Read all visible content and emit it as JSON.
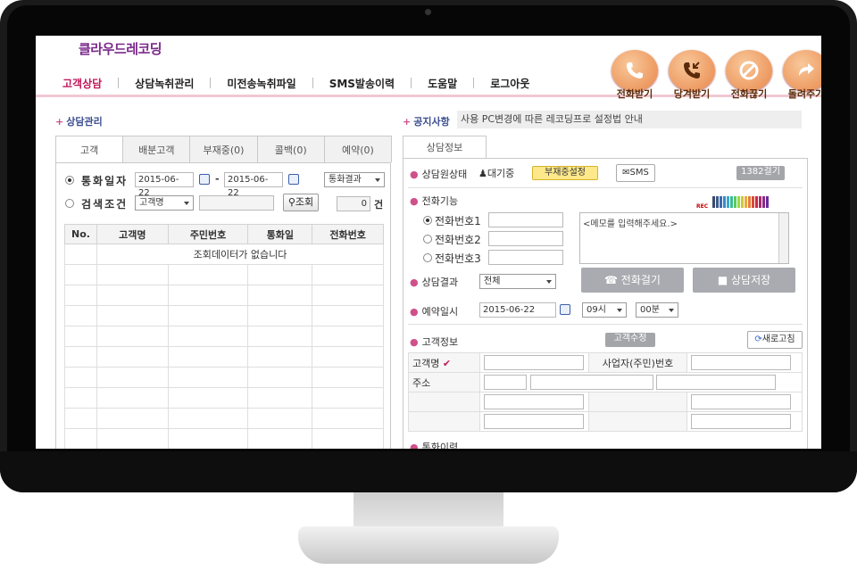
{
  "brand": "클라우드레코딩",
  "nav": [
    "고객상담",
    "상담녹취관리",
    "미전송녹취파일",
    "SMS발송이력",
    "도움말",
    "로그아웃"
  ],
  "call_buttons": [
    {
      "label": "전화받기",
      "icon": "phone-receive-icon"
    },
    {
      "label": "당겨받기",
      "icon": "phone-pickup-icon"
    },
    {
      "label": "전화끊기",
      "icon": "phone-hangup-icon"
    },
    {
      "label": "돌려주기",
      "icon": "phone-transfer-icon"
    }
  ],
  "left": {
    "title": "상담관리",
    "tabs": [
      "고객",
      "배분고객",
      "부재중(0)",
      "콜백(0)",
      "예약(0)"
    ],
    "search": {
      "opt_date": "통화일자",
      "date_from": "2015-06-22",
      "date_to": "2015-06-22",
      "range_sep": "-",
      "result_select": "통화결과",
      "opt_cond": "검색조건",
      "cond_select": "고객명",
      "search_btn": "조회",
      "count_value": "0",
      "count_unit": "건"
    },
    "table": {
      "headers": [
        "No.",
        "고객명",
        "주민번호",
        "통화일",
        "전화번호"
      ],
      "empty_text": "조회데이터가 없습니다"
    }
  },
  "notice": {
    "label": "공지사항",
    "text": "사용 PC변경에 따른 레코딩프로 설정법 안내"
  },
  "right": {
    "tab": "상담정보",
    "status_label": "상담원상태",
    "status_value": "대기중",
    "absent_btn": "부재중설정",
    "sms_btn": "SMS",
    "counter_btn": "1382걸기",
    "phone_func_label": "전화기능",
    "rec_label": "REC",
    "phones": [
      "전화번호1",
      "전화번호2",
      "전화번호3"
    ],
    "memo_placeholder": "<메모를 입력해주세요.>",
    "result_label": "상담결과",
    "result_select": "전체",
    "call_btn": "전화걸기",
    "save_btn": "상담저장",
    "reserve_label": "예약일시",
    "reserve_date": "2015-06-22",
    "reserve_hour": "09시",
    "reserve_min": "00분",
    "customer_label": "고객정보",
    "customer_edit_btn": "고객수정",
    "refresh_btn": "새로고침",
    "field_name": "고객명",
    "field_bizno": "사업자(주민)번호",
    "field_addr": "주소",
    "history_label": "통화이력"
  }
}
